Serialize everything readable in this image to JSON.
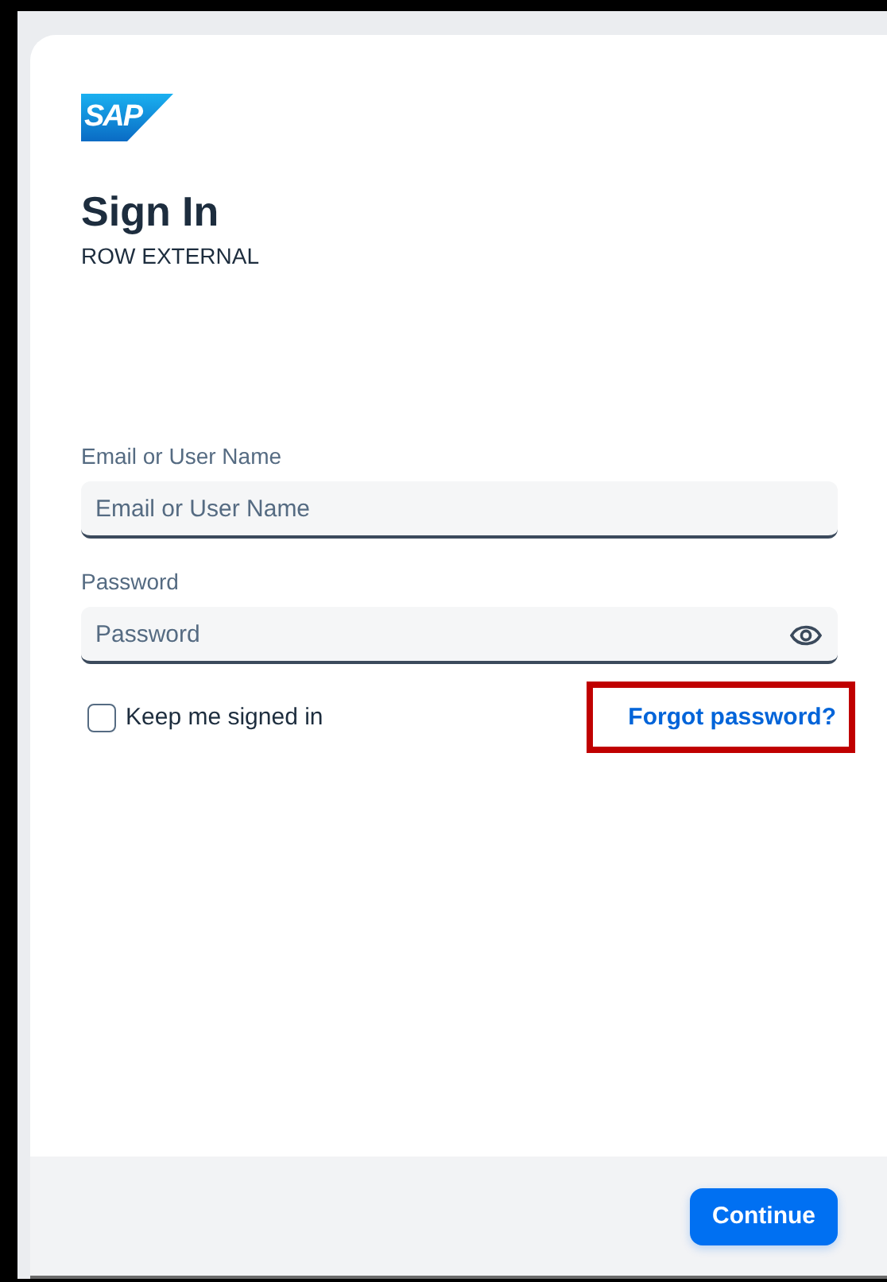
{
  "logo": {
    "text": "SAP"
  },
  "title": "Sign In",
  "subtitle": "ROW EXTERNAL",
  "fields": [
    {
      "kind": "text",
      "label": "Email or User Name",
      "placeholder": "Email or User Name"
    },
    {
      "kind": "password",
      "label": "Password",
      "placeholder": "Password"
    }
  ],
  "keep_signed_in": {
    "label": "Keep me signed in",
    "checked": false
  },
  "forgot_link": {
    "label": "Forgot password?",
    "highlighted": true
  },
  "footer": {
    "button": "Continue"
  }
}
